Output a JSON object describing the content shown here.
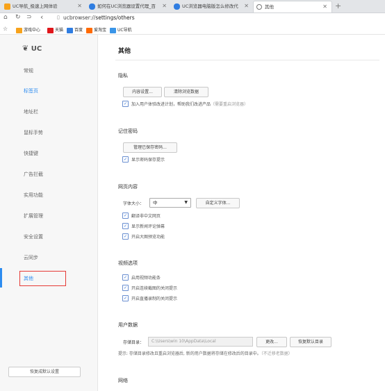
{
  "tabs": [
    {
      "label": "UC导航_极速上网体验",
      "active": false,
      "icon_color": "#f7a21b",
      "icon": "uc-icon"
    },
    {
      "label": "如何在UC浏览器设置代理_百",
      "active": false,
      "icon_color": "#2f7de1",
      "icon": "paw-icon"
    },
    {
      "label": "UC浏览器电脑版怎么修改代",
      "active": false,
      "icon_color": "#2f7de1",
      "icon": "paw-icon"
    },
    {
      "label": "其他",
      "active": true,
      "icon_color": "#777777",
      "icon": "gear-icon"
    }
  ],
  "newtab": "+",
  "url": {
    "scheme": "ucbrowser://",
    "path": "settings/others"
  },
  "nav_glyphs": {
    "home": "⌂",
    "refresh": "↻",
    "forward": "⊃",
    "back": "‹"
  },
  "bookmarks": [
    {
      "label": "游戏中心",
      "color": "#f7a21b"
    },
    {
      "label": "天猫",
      "color": "#e0161b"
    },
    {
      "label": "百度",
      "color": "#2f7de1"
    },
    {
      "label": "爱淘宝",
      "color": "#ff6a00"
    },
    {
      "label": "UC导航",
      "color": "#3a95e8"
    }
  ],
  "sidebar": {
    "logo": "UC",
    "items": [
      "常规",
      "标签页",
      "地址栏",
      "鼠标手势",
      "快捷键",
      "广告拦截",
      "实用功能",
      "扩展管理",
      "安全设置",
      "云同步",
      "其他"
    ],
    "reset_label": "恢复成默认设置"
  },
  "main": {
    "title": "其他",
    "privacy": {
      "heading": "隐私",
      "content_settings": "内容设置...",
      "clear_data": "清除浏览数据",
      "join_ux": "加入用户体验改进计划，帮助我们改进产品",
      "join_ux_hint": "（需要重启浏览器）"
    },
    "password": {
      "heading": "记住密码",
      "manage": "管理已保存密码...",
      "show_prompt": "显示密码保存提示"
    },
    "webcontent": {
      "heading": "网页内容",
      "font_size_label": "字体大小：",
      "font_size_value": "中",
      "custom_font": "自定义字体...",
      "opts": [
        "翻译非中文网页",
        "显示新闻评论弹幕",
        "开启大图预览功能"
      ]
    },
    "video": {
      "heading": "视频选项",
      "opts": [
        "启用视频功能条",
        "开启连续截图的关闭提示",
        "开启直播录制的关闭提示"
      ]
    },
    "userdata": {
      "heading": "用户数据",
      "dir_label": "存储目录：",
      "dir_value": "C:\\Users\\win 10\\AppData\\Local",
      "change": "更改...",
      "restore": "恢复默认目录",
      "note": "提示: 存储目录修改且重启浏览器后, 新的用户数据将存储在修改后的目录中。",
      "note_hint": "（不迁移老数据）"
    },
    "network": {
      "heading": "网络"
    }
  }
}
